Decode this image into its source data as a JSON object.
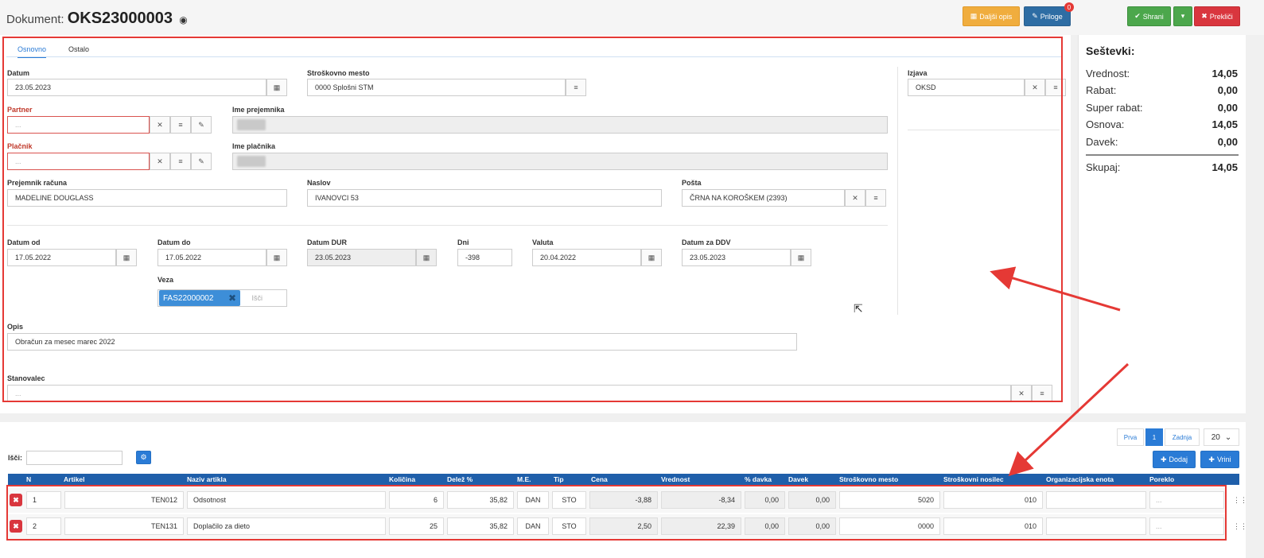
{
  "header": {
    "doc_label": "Dokument:",
    "doc_number": "OKS23000003",
    "more_btn": "Daljši opis",
    "attach_btn": "Priloge",
    "attach_count": "0",
    "save_btn": "Shrani",
    "cancel_btn": "Prekliči"
  },
  "tabs": [
    "Osnovno",
    "Ostalo"
  ],
  "form": {
    "datum": {
      "label": "Datum",
      "value": "23.05.2023"
    },
    "stroskovno_mesto": {
      "label": "Stroškovno mesto",
      "value": "0000 Splošni STM"
    },
    "izjava": {
      "label": "Izjava",
      "value": "OKSD"
    },
    "partner": {
      "label": "Partner",
      "placeholder": "..."
    },
    "ime_prejemnika": {
      "label": "Ime prejemnika"
    },
    "placnik": {
      "label": "Plačnik",
      "placeholder": "..."
    },
    "ime_placnika": {
      "label": "Ime plačnika"
    },
    "prejemnik_racuna": {
      "label": "Prejemnik računa",
      "value": "MADELINE DOUGLASS"
    },
    "naslov": {
      "label": "Naslov",
      "value": "IVANOVCI 53"
    },
    "posta": {
      "label": "Pošta",
      "value": "ČRNA NA KOROŠKEM (2393)"
    },
    "datum_od": {
      "label": "Datum od",
      "value": "17.05.2022"
    },
    "datum_do": {
      "label": "Datum do",
      "value": "17.05.2022"
    },
    "datum_dur": {
      "label": "Datum DUR",
      "value": "23.05.2023"
    },
    "dni": {
      "label": "Dni",
      "value": "-398"
    },
    "valuta": {
      "label": "Valuta",
      "value": "20.04.2022"
    },
    "datum_ddv": {
      "label": "Datum za DDV",
      "value": "23.05.2023"
    },
    "veza": {
      "label": "Veza",
      "tag": "FAS22000002",
      "search_placeholder": "Išči"
    },
    "opis": {
      "label": "Opis",
      "value": "Obračun za mesec marec 2022"
    },
    "stanovalec": {
      "label": "Stanovalec",
      "placeholder": "..."
    }
  },
  "summary": {
    "title": "Seštevki:",
    "rows": [
      {
        "label": "Vrednost:",
        "value": "14,05"
      },
      {
        "label": "Rabat:",
        "value": "0,00"
      },
      {
        "label": "Super rabat:",
        "value": "0,00"
      },
      {
        "label": "Osnova:",
        "value": "14,05"
      },
      {
        "label": "Davek:",
        "value": "0,00"
      }
    ],
    "total_label": "Skupaj:",
    "total_value": "14,05"
  },
  "table": {
    "search_label": "Išči:",
    "pager": {
      "first": "Prva",
      "current": "1",
      "last": "Zadnja",
      "page_size": "20"
    },
    "add_btn": "Dodaj",
    "insert_btn": "Vrini",
    "columns": [
      "N",
      "Artikel",
      "Naziv artikla",
      "Količina",
      "Delež %",
      "M.E.",
      "Tip",
      "Cena",
      "Vrednost",
      "% davka",
      "Davek",
      "Stroškovno mesto",
      "Stroškovni nosilec",
      "Organizacijska enota",
      "Poreklo"
    ],
    "rows": [
      {
        "n": "1",
        "artikel": "TEN012",
        "naziv": "Odsotnost",
        "kolicina": "6",
        "delez": "35,82",
        "me": "DAN",
        "tip": "STO",
        "cena": "-3,88",
        "vrednost": "-8,34",
        "pdavka": "0,00",
        "davek": "0,00",
        "stm": "5020",
        "nosilec": "010",
        "org": "",
        "poreklo": "..."
      },
      {
        "n": "2",
        "artikel": "TEN131",
        "naziv": "Doplačilo za dieto",
        "kolicina": "25",
        "delez": "35,82",
        "me": "DAN",
        "tip": "STO",
        "cena": "2,50",
        "vrednost": "22,39",
        "pdavka": "0,00",
        "davek": "0,00",
        "stm": "0000",
        "nosilec": "010",
        "org": "",
        "poreklo": "..."
      }
    ]
  },
  "colors": {
    "accent": "#2a7bd6",
    "annotation": "#e53935",
    "save": "#4ca74c",
    "cancel": "#d9363e",
    "more": "#f0ad3e"
  }
}
